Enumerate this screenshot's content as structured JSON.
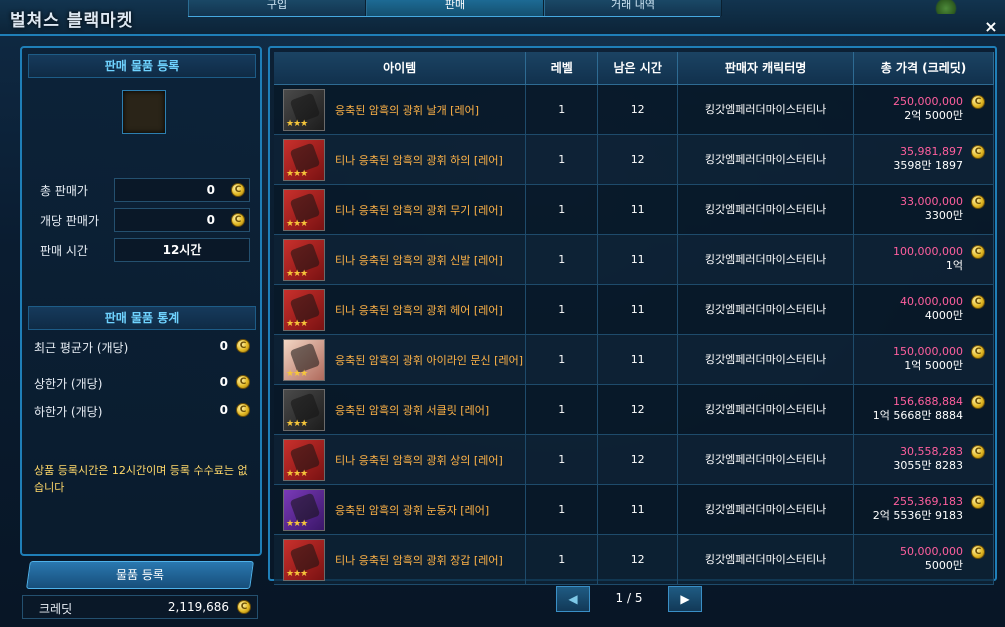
{
  "app": {
    "title": "벌쳐스 블랙마켓",
    "close_icon": "×"
  },
  "tabs": [
    {
      "label": "구입",
      "active": false
    },
    {
      "label": "판매",
      "active": true
    },
    {
      "label": "거래 내역",
      "active": false
    }
  ],
  "sell_form": {
    "title": "판매 물품 등록",
    "total_price_label": "총 판매가",
    "total_price_value": "0",
    "unit_price_label": "개당 판매가",
    "unit_price_value": "0",
    "sale_time_label": "판매 시간",
    "sale_time_value": "12시간"
  },
  "stats": {
    "title": "판매 물품 통계",
    "recent_avg_label": "최근 평균가 (개당)",
    "recent_avg_value": "0",
    "upper_label": "상한가 (개당)",
    "upper_value": "0",
    "lower_label": "하한가 (개당)",
    "lower_value": "0"
  },
  "notice": "상품 등록시간은 12시간이며 등록 수수료는 없습니다",
  "register_button": "물품 등록",
  "credit": {
    "label": "크레딧",
    "value": "2,119,686"
  },
  "table": {
    "headers": [
      "아이템",
      "레벨",
      "남은 시간",
      "판매자 캐릭터명",
      "총 가격 (크레딧)"
    ],
    "rows": [
      {
        "name": "응축된 암흑의 광휘 날개 [레어]",
        "level": "1",
        "time": "12",
        "seller": "킹갓엠페러더마이스터티나",
        "price": "250,000,000",
        "price_kr": "2억 5000만",
        "thumb": "dark",
        "stars": "★★★"
      },
      {
        "name": "티나 응축된 암흑의 광휘 하의 [레어]",
        "level": "1",
        "time": "12",
        "seller": "킹갓엠페러더마이스터티나",
        "price": "35,981,897",
        "price_kr": "3598만 1897",
        "thumb": "red",
        "stars": "★★★"
      },
      {
        "name": "티나 응축된 암흑의 광휘 무기 [레어]",
        "level": "1",
        "time": "11",
        "seller": "킹갓엠페러더마이스터티나",
        "price": "33,000,000",
        "price_kr": "3300만",
        "thumb": "red",
        "stars": "★★★"
      },
      {
        "name": "티나 응축된 암흑의 광휘 신발 [레어]",
        "level": "1",
        "time": "11",
        "seller": "킹갓엠페러더마이스터티나",
        "price": "100,000,000",
        "price_kr": "1억",
        "thumb": "red",
        "stars": "★★★"
      },
      {
        "name": "티나 응축된 암흑의 광휘 헤어 [레어]",
        "level": "1",
        "time": "11",
        "seller": "킹갓엠페러더마이스터티나",
        "price": "40,000,000",
        "price_kr": "4000만",
        "thumb": "red",
        "stars": "★★★"
      },
      {
        "name": "응축된 암흑의 광휘 아이라인 문신 [레어]",
        "level": "1",
        "time": "11",
        "seller": "킹갓엠페러더마이스터티나",
        "price": "150,000,000",
        "price_kr": "1억 5000만",
        "thumb": "pale",
        "stars": "★★★"
      },
      {
        "name": "응축된 암흑의 광휘 서클릿 [레어]",
        "level": "1",
        "time": "12",
        "seller": "킹갓엠페러더마이스터티나",
        "price": "156,688,884",
        "price_kr": "1억 5668만 8884",
        "thumb": "dark",
        "stars": "★★★"
      },
      {
        "name": "티나 응축된 암흑의 광휘 상의 [레어]",
        "level": "1",
        "time": "12",
        "seller": "킹갓엠페러더마이스터티나",
        "price": "30,558,283",
        "price_kr": "3055만 8283",
        "thumb": "red",
        "stars": "★★★"
      },
      {
        "name": "응축된 암흑의 광휘 눈동자 [레어]",
        "level": "1",
        "time": "11",
        "seller": "킹갓엠페러더마이스터티나",
        "price": "255,369,183",
        "price_kr": "2억 5536만 9183",
        "thumb": "purple",
        "stars": "★★★"
      },
      {
        "name": "티나 응축된 암흑의 광휘 장갑 [레어]",
        "level": "1",
        "time": "12",
        "seller": "킹갓엠페러더마이스터티나",
        "price": "50,000,000",
        "price_kr": "5000만",
        "thumb": "red",
        "stars": "★★★"
      }
    ]
  },
  "pager": {
    "prev": "◀",
    "next": "▶",
    "text": "1 / 5"
  },
  "icons": {
    "coin": "coin-icon"
  },
  "colors": {
    "accent": "#1f7fb8",
    "item_name": "#ffb347",
    "price_main": "#ff5f9e",
    "notice": "#ffd86a"
  }
}
